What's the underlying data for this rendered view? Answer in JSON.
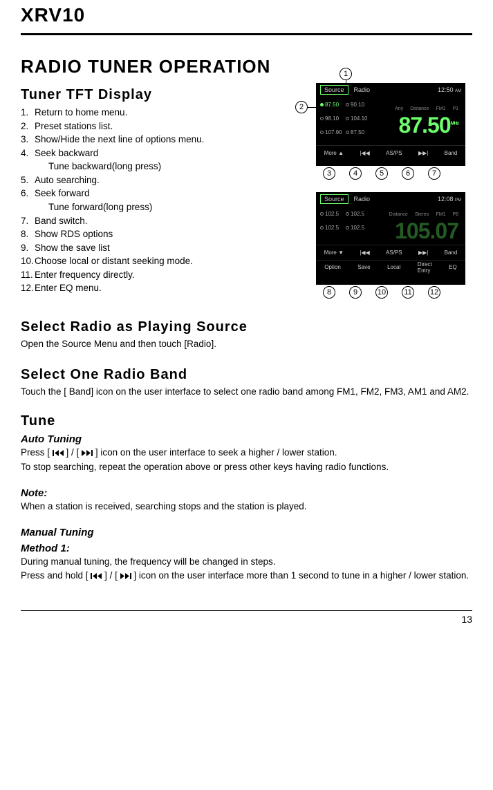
{
  "model": "XRV10",
  "sectionTitle": "RADIO TUNER OPERATION",
  "tftTitle": "Tuner TFT Display",
  "listItems": [
    {
      "n": "1.",
      "t": "Return to home menu."
    },
    {
      "n": "2.",
      "t": "Preset stations list."
    },
    {
      "n": "3.",
      "t": "Show/Hide the next line of options menu."
    },
    {
      "n": "4.",
      "t": "Seek backward"
    },
    {
      "n": "",
      "t": "Tune backward(long press)"
    },
    {
      "n": "5.",
      "t": "Auto searching."
    },
    {
      "n": "6.",
      "t": "Seek forward"
    },
    {
      "n": "",
      "t": "Tune forward(long press)"
    },
    {
      "n": "7.",
      "t": "Band switch."
    },
    {
      "n": "8.",
      "t": "Show RDS options"
    },
    {
      "n": "9.",
      "t": "Show the save list"
    },
    {
      "n": "10.",
      "t": "Choose local or distant seeking mode."
    },
    {
      "n": "11.",
      "t": "Enter frequency directly."
    },
    {
      "n": "12.",
      "t": "Enter EQ menu."
    }
  ],
  "radio1": {
    "source": "Source",
    "title": "Radio",
    "clock": "12:50",
    "ampm": "AM",
    "status": {
      "dist": "Distance",
      "band": "FM1",
      "preset": "P1",
      "any": "Any"
    },
    "presets": [
      [
        "87.50",
        true
      ],
      [
        "90.10",
        false
      ],
      [
        "98.10",
        false
      ],
      [
        "104.10",
        false
      ],
      [
        "107.90",
        false
      ],
      [
        "87.50",
        false
      ]
    ],
    "freq": "87.50",
    "unit": "MHz",
    "bottom": [
      "More ▲",
      "|◀◀",
      "AS/PS",
      "▶▶|",
      "Band"
    ]
  },
  "radio2": {
    "source": "Source",
    "title": "Radio",
    "clock": "12:08",
    "ampm": "PM",
    "status": {
      "dist": "Distance",
      "stereo": "Stereo",
      "band": "FM1",
      "preset": "P6"
    },
    "presets": [
      [
        "102.5",
        false
      ],
      [
        "102.5",
        false
      ],
      [
        "102.5",
        false
      ],
      [
        "102.5",
        false
      ]
    ],
    "freq": "105.07",
    "unit": "",
    "bottom": [
      "More ▼",
      "|◀◀",
      "AS/PS",
      "▶▶|",
      "Band"
    ],
    "extra": [
      "Option",
      "Save",
      "Local",
      "Direct\nEntry",
      "EQ"
    ]
  },
  "selectRadio": {
    "title": "Select Radio as Playing Source",
    "text": "Open the Source Menu and then touch [Radio]."
  },
  "selectBand": {
    "title": "Select One Radio Band",
    "text": "Touch the [ Band] icon on the user interface to select one radio band among FM1, FM2, FM3, AM1 and AM2."
  },
  "tune": {
    "title": "Tune"
  },
  "autoTune": {
    "title": "Auto Tuning",
    "l1a": "Press [",
    "l1b": "] / [",
    "l1c": "] icon on the user interface to seek a higher / lower station.",
    "l2": "To stop searching, repeat the operation above or press other keys having radio functions."
  },
  "note": {
    "title": "Note:",
    "text": "When a station is received, searching stops and the station is played."
  },
  "manual": {
    "title": "Manual Tuning",
    "method": "Method 1:",
    "l1": "During manual tuning, the frequency will be changed in steps.",
    "l2a": "Press and hold [",
    "l2b": "] / [",
    "l2c": "] icon on the user interface more than 1 second to tune in a higher / lower station."
  },
  "pageNum": "13",
  "callouts1": [
    "3",
    "4",
    "5",
    "6",
    "7"
  ],
  "callouts2": [
    "8",
    "9",
    "10",
    "11",
    "12"
  ]
}
